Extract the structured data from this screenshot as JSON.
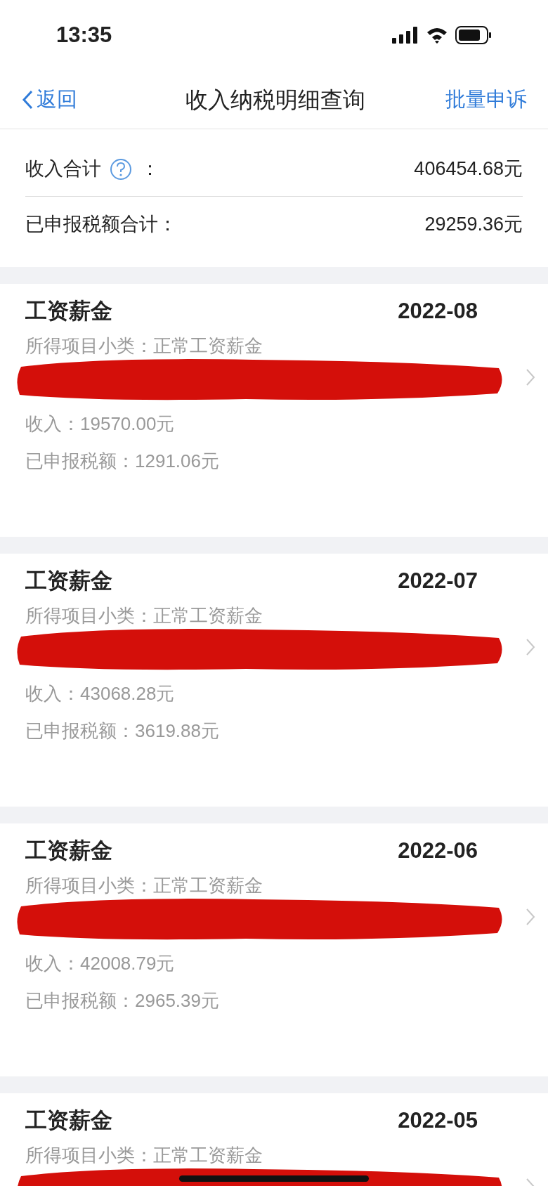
{
  "status_bar": {
    "time": "13:35"
  },
  "nav": {
    "back": "返回",
    "title": "收入纳税明细查询",
    "action": "批量申诉"
  },
  "summary": [
    {
      "label": "收入合计",
      "help": true,
      "colon": "：",
      "value": "406454.68元"
    },
    {
      "label": "已申报税额合计：",
      "help": false,
      "value": "29259.36元"
    }
  ],
  "records": [
    {
      "title": "工资薪金",
      "period": "2022-08",
      "subtype": "所得项目小类：正常工资薪金",
      "redacted": true,
      "income": "收入：19570.00元",
      "tax": "已申报税额：1291.06元"
    },
    {
      "title": "工资薪金",
      "period": "2022-07",
      "subtype": "所得项目小类：正常工资薪金",
      "redacted": true,
      "income": "收入：43068.28元",
      "tax": "已申报税额：3619.88元"
    },
    {
      "title": "工资薪金",
      "period": "2022-06",
      "subtype": "所得项目小类：正常工资薪金",
      "redacted": true,
      "income": "收入：42008.79元",
      "tax": "已申报税额：2965.39元"
    },
    {
      "title": "工资薪金",
      "period": "2022-05",
      "subtype": "所得项目小类：正常工资薪金",
      "redacted": true
    }
  ]
}
